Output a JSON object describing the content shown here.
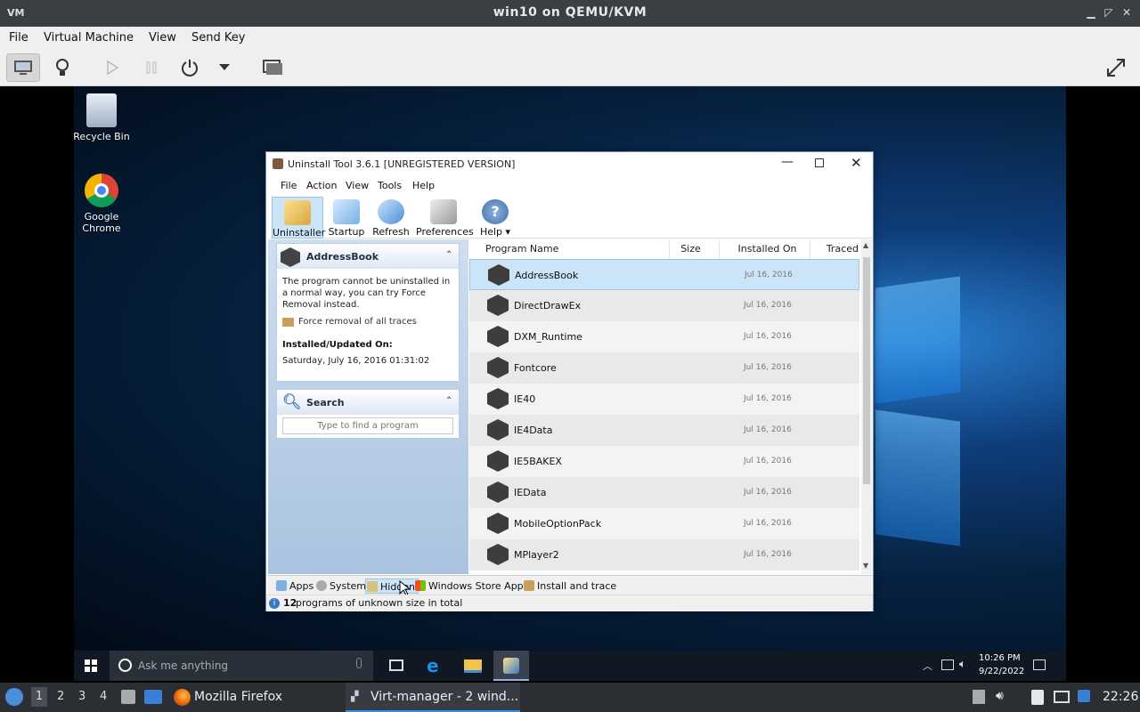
{
  "vm": {
    "title": "win10 on QEMU/KVM",
    "logo": "VM",
    "menu": [
      "File",
      "Virtual Machine",
      "View",
      "Send Key"
    ],
    "toolbar_icons": [
      "console-icon",
      "details-lightbulb-icon",
      "run-icon",
      "pause-icon",
      "power-icon",
      "dropdown-icon",
      "snapshot-icon"
    ],
    "fullscreen_icon": "fullscreen-icon"
  },
  "desktop": {
    "icons": [
      {
        "label": "Recycle Bin",
        "icon": "recycle-bin-icon"
      },
      {
        "label": "Google Chrome",
        "icon": "chrome-icon"
      }
    ]
  },
  "ut": {
    "title": "Uninstall Tool 3.6.1 [UNREGISTERED VERSION]",
    "menu": [
      "File",
      "Action",
      "View",
      "Tools",
      "Help"
    ],
    "toolbar": [
      {
        "label": "Uninstaller"
      },
      {
        "label": "Startup"
      },
      {
        "label": "Refresh"
      },
      {
        "label": "Preferences"
      },
      {
        "label": "Help ▾"
      }
    ],
    "details": {
      "name": "AddressBook",
      "message": "The program cannot be uninstalled in a normal way, you can try Force Removal instead.",
      "force_link": "Force removal of all traces",
      "installed_label": "Installed/Updated On:",
      "installed_value": "Saturday, July 16, 2016 01:31:02"
    },
    "search": {
      "title": "Search",
      "placeholder": "Type to find a program"
    },
    "columns": [
      "Program Name",
      "Size",
      "Installed On",
      "Traced"
    ],
    "rows": [
      {
        "name": "AddressBook",
        "date": "Jul 16, 2016"
      },
      {
        "name": "DirectDrawEx",
        "date": "Jul 16, 2016"
      },
      {
        "name": "DXM_Runtime",
        "date": "Jul 16, 2016"
      },
      {
        "name": "Fontcore",
        "date": "Jul 16, 2016"
      },
      {
        "name": "IE40",
        "date": "Jul 16, 2016"
      },
      {
        "name": "IE4Data",
        "date": "Jul 16, 2016"
      },
      {
        "name": "IE5BAKEX",
        "date": "Jul 16, 2016"
      },
      {
        "name": "IEData",
        "date": "Jul 16, 2016"
      },
      {
        "name": "MobileOptionPack",
        "date": "Jul 16, 2016"
      },
      {
        "name": "MPlayer2",
        "date": "Jul 16, 2016"
      }
    ],
    "tabs": [
      "Apps",
      "System",
      "Hidden",
      "Windows Store Apps",
      "Install and trace"
    ],
    "status": {
      "count": "12",
      "text": " programs of unknown size in total"
    }
  },
  "win10": {
    "search_placeholder": "Ask me anything",
    "time": "10:26 PM",
    "date": "9/22/2022"
  },
  "host": {
    "workspaces": [
      "1",
      "2",
      "3",
      "4"
    ],
    "firefox": "Mozilla Firefox",
    "virtmanager": "Virt-manager - 2 wind...",
    "clock": "22:26"
  },
  "colors": {
    "selection": "#cce4f7",
    "accent": "#1a7fe0"
  }
}
